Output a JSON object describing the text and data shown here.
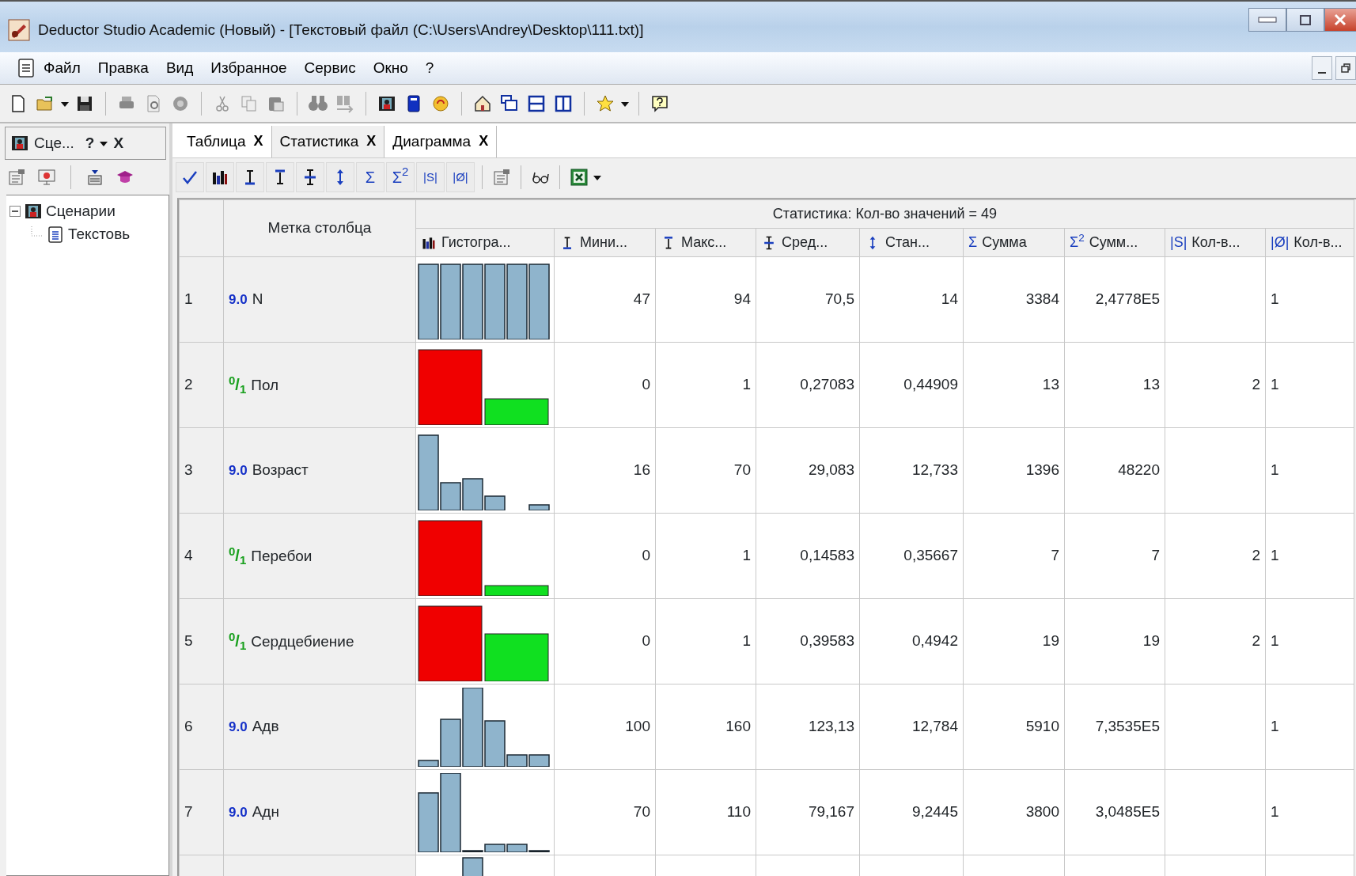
{
  "window": {
    "title": "Deductor Studio Academic (Новый) - [Текстовый файл (C:\\Users\\Andrey\\Desktop\\111.txt)]"
  },
  "menu": [
    "Файл",
    "Правка",
    "Вид",
    "Избранное",
    "Сервис",
    "Окно",
    "?"
  ],
  "left_pane": {
    "title": "Сце...",
    "help": "?",
    "close": "X",
    "tree": [
      {
        "label": "Сценарии",
        "expanded": true,
        "children": [
          {
            "label": "Текстовь"
          }
        ]
      }
    ]
  },
  "tabs": [
    {
      "label": "Таблица",
      "close": "X",
      "selected": false
    },
    {
      "label": "Статистика",
      "close": "X",
      "selected": true
    },
    {
      "label": "Диаграмма",
      "close": "X",
      "selected": false
    }
  ],
  "stat_toolbar": [
    "Σ",
    "Σ$^{2}$",
    "|S|",
    "|Ø|"
  ],
  "table": {
    "label_header": "Метка столбца",
    "group_header": "Статистика: Кол-во значений = 49",
    "columns": [
      {
        "label": "Гистогра..."
      },
      {
        "label": "Мини..."
      },
      {
        "label": "Макс..."
      },
      {
        "label": "Сред..."
      },
      {
        "label": "Стан..."
      },
      {
        "glyph": "Σ",
        "label": "Сумма"
      },
      {
        "glyph": "Σ$^{2}$",
        "label": "Сумм..."
      },
      {
        "glyph": "|S|",
        "label": "Кол-в..."
      },
      {
        "glyph": "|Ø|",
        "label": "Кол-в..."
      }
    ],
    "rows": [
      {
        "num": "1",
        "kind": "numeric",
        "type": "9.0",
        "name": "N",
        "min": "47",
        "max": "94",
        "mean": "70,5",
        "std": "14",
        "sum": "3384",
        "sum2": "2,4778E5",
        "count_s": null,
        "count_0": "1"
      },
      {
        "num": "2",
        "kind": "binary",
        "type": "$^{0}$/$_{1}$",
        "name": "Пол",
        "min": "0",
        "max": "1",
        "mean": "0,27083",
        "std": "0,44909",
        "sum": "13",
        "sum2": "13",
        "count_s": "2",
        "count_0": "1"
      },
      {
        "num": "3",
        "kind": "numeric",
        "type": "9.0",
        "name": "Возраст",
        "min": "16",
        "max": "70",
        "mean": "29,083",
        "std": "12,733",
        "sum": "1396",
        "sum2": "48220",
        "count_s": null,
        "count_0": "1"
      },
      {
        "num": "4",
        "kind": "binary",
        "type": "$^{0}$/$_{1}$",
        "name": "Перебои",
        "min": "0",
        "max": "1",
        "mean": "0,14583",
        "std": "0,35667",
        "sum": "7",
        "sum2": "7",
        "count_s": "2",
        "count_0": "1"
      },
      {
        "num": "5",
        "kind": "binary",
        "type": "$^{0}$/$_{1}$",
        "name": "Сердцебиение",
        "min": "0",
        "max": "1",
        "mean": "0,39583",
        "std": "0,4942",
        "sum": "19",
        "sum2": "19",
        "count_s": "2",
        "count_0": "1"
      },
      {
        "num": "6",
        "kind": "numeric",
        "type": "9.0",
        "name": "Адв",
        "min": "100",
        "max": "160",
        "mean": "123,13",
        "std": "12,784",
        "sum": "5910",
        "sum2": "7,3535E5",
        "count_s": null,
        "count_0": "1"
      },
      {
        "num": "7",
        "kind": "numeric",
        "type": "9.0",
        "name": "Адн",
        "min": "70",
        "max": "110",
        "mean": "79,167",
        "std": "9,2445",
        "sum": "3800",
        "sum2": "3,0485E5",
        "count_s": null,
        "count_0": "1"
      }
    ]
  }
}
